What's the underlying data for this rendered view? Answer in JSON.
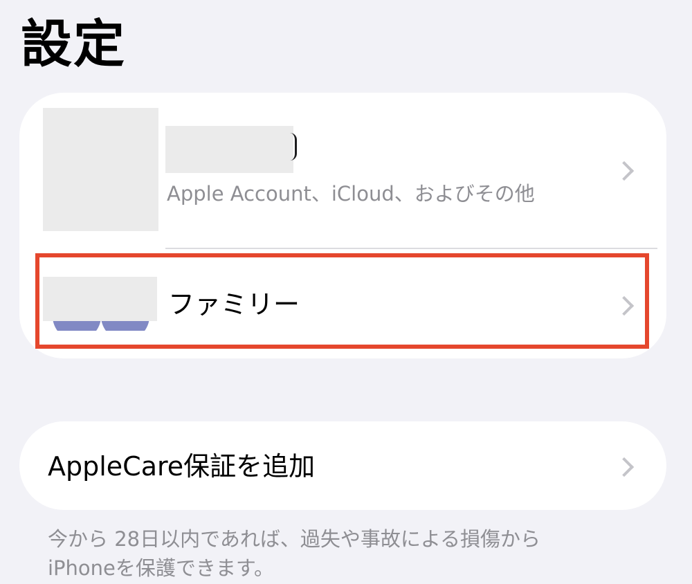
{
  "header": {
    "title": "設定"
  },
  "account": {
    "subtitle": "Apple Account、iCloud、およびその他"
  },
  "family": {
    "label": "ファミリー"
  },
  "applecare": {
    "label": "AppleCare保証を追加",
    "footnote_line1": "今から 28日以内であれば、過失や事故による損傷から",
    "footnote_line2": "iPhoneを保護できます。"
  },
  "icons": {
    "chevron": "chevron-right-icon"
  },
  "colors": {
    "background": "#f2f2f7",
    "card": "#ffffff",
    "secondary_text": "#8e8e93",
    "chevron": "#c4c4c9",
    "highlight": "#e5472d",
    "family_avatar": "#8189c4"
  }
}
